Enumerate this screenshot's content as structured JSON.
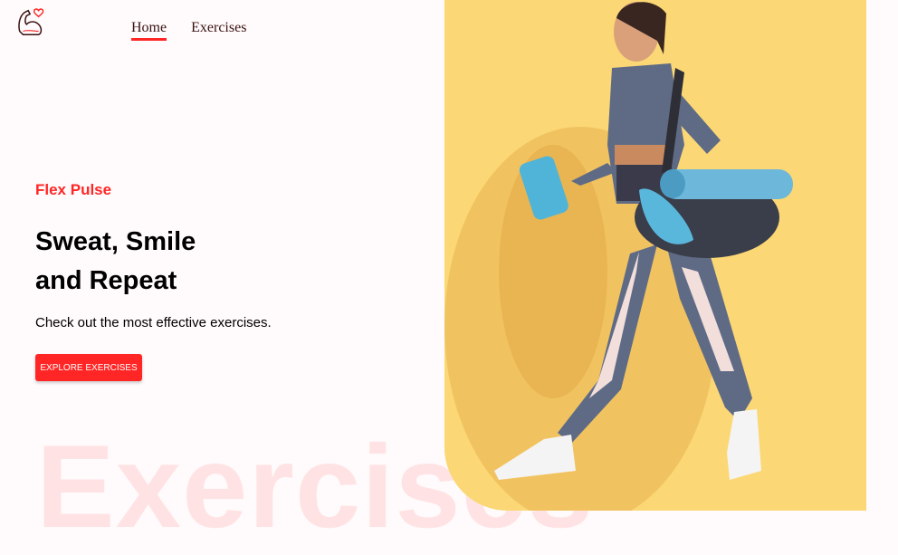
{
  "nav": {
    "logo_icon": "flexed-arm-heart-icon",
    "items": [
      {
        "label": "Home",
        "active": true
      },
      {
        "label": "Exercises",
        "active": false
      }
    ]
  },
  "hero": {
    "brand": "Flex Pulse",
    "headline_line1": "Sweat, Smile",
    "headline_line2": "and Repeat",
    "subtitle": "Check out the most effective exercises.",
    "cta_label": "EXPLORE EXERCISES",
    "watermark": "Exercises",
    "image_alt": "woman-walking-with-gym-bag-photo"
  },
  "colors": {
    "accent": "#ff2625",
    "background": "#fffafb",
    "hero_bg": "#fbd875"
  }
}
